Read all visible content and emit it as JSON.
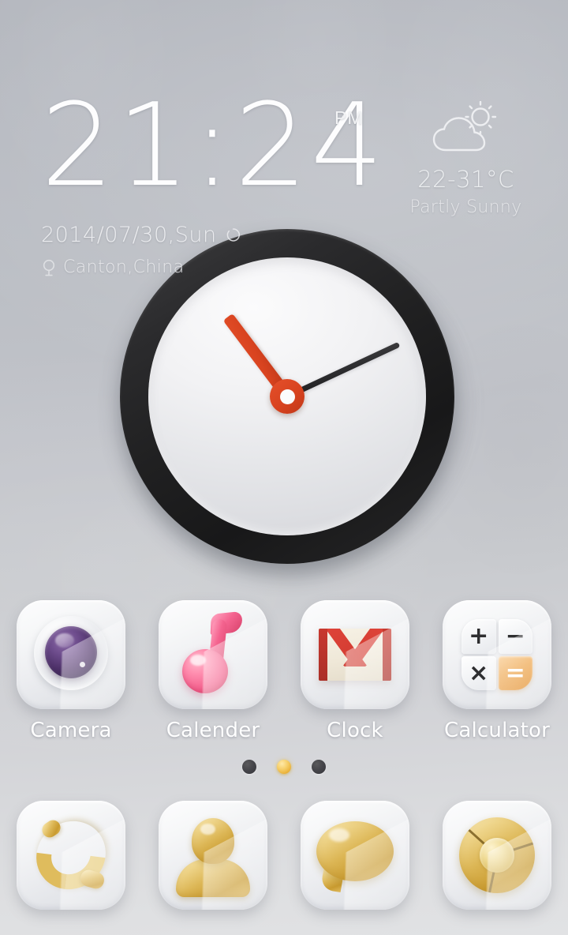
{
  "wallpaper": {
    "top_color": "#b5b8bf",
    "bottom_color": "#e1e2e4"
  },
  "time_widget": {
    "time": "21:24",
    "meridiem": "PM",
    "date": "2014/07/30,Sun",
    "refresh_icon": "refresh-icon",
    "location_icon": "location-pin-icon",
    "location": "Canton,China"
  },
  "weather_widget": {
    "icon": "sun-behind-cloud-icon",
    "temperature": "22-31°C",
    "condition": "Partly Sunny"
  },
  "analog_clock": {
    "bezel_color": "#202021",
    "face_color": "#eeeff1",
    "hour_hand_color": "#d8431f",
    "minute_hand_color": "#2a2a2c",
    "hour_hand_rotation_deg": -37,
    "minute_hand_rotation_deg": 65
  },
  "app_grid": {
    "apps": [
      {
        "label": "Camera",
        "icon": "camera-lens-icon"
      },
      {
        "label": "Calender",
        "icon": "pink-music-note-icon"
      },
      {
        "label": "Clock",
        "icon": "red-envelope-mail-icon"
      },
      {
        "label": "Calculator",
        "icon": "calculator-keys-icon"
      }
    ]
  },
  "calculator_icon": {
    "keys": [
      "+",
      "−",
      "×",
      "="
    ],
    "equals_color": "#e0871f"
  },
  "page_indicator": {
    "total": 3,
    "active_index": 1,
    "active_color": "#e8ae33",
    "inactive_color": "#404045"
  },
  "dock": {
    "items": [
      {
        "name": "phone",
        "icon": "gold-phone-handset-icon"
      },
      {
        "name": "contacts",
        "icon": "gold-person-icon"
      },
      {
        "name": "messages",
        "icon": "gold-speech-bubble-icon"
      },
      {
        "name": "browser",
        "icon": "gold-chrome-browser-icon"
      }
    ]
  }
}
